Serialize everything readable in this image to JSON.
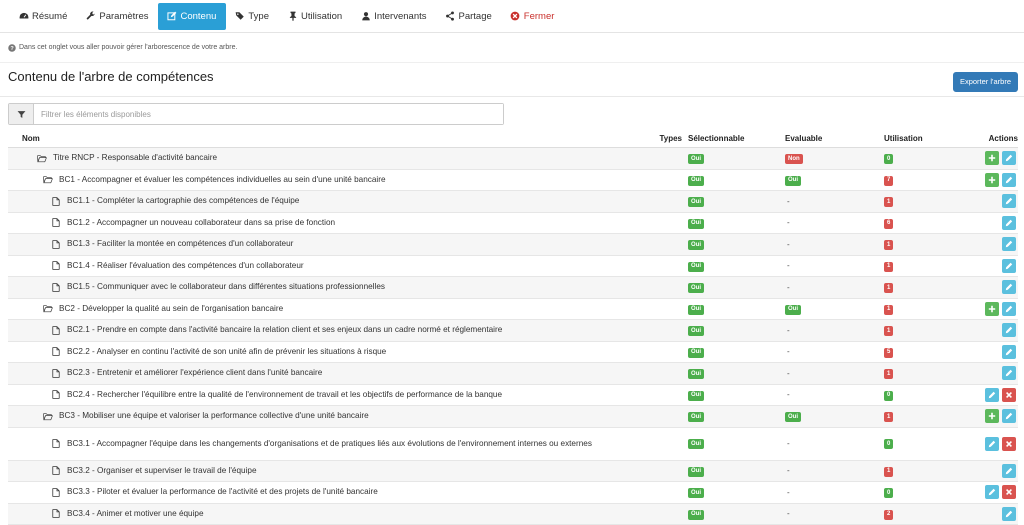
{
  "tabs": [
    {
      "id": "resume",
      "label": "Résumé",
      "icon": "dashboard-icon",
      "active": false
    },
    {
      "id": "parametres",
      "label": "Paramètres",
      "icon": "wrench-icon",
      "active": false
    },
    {
      "id": "contenu",
      "label": "Contenu",
      "icon": "edit-icon",
      "active": true
    },
    {
      "id": "type",
      "label": "Type",
      "icon": "tags-icon",
      "active": false
    },
    {
      "id": "utilisation",
      "label": "Utilisation",
      "icon": "pin-icon",
      "active": false
    },
    {
      "id": "intervenants",
      "label": "Intervenants",
      "icon": "user-icon",
      "active": false
    },
    {
      "id": "partage",
      "label": "Partage",
      "icon": "share-icon",
      "active": false
    },
    {
      "id": "fermer",
      "label": "Fermer",
      "icon": "close-circle-icon",
      "active": false
    }
  ],
  "info_text": "Dans cet onglet vous aller pouvoir gérer l'arborescence de votre arbre.",
  "page_title": "Contenu de l'arbre de compétences",
  "export_label": "Exporter l'arbre",
  "filter_placeholder": "Filtrer les éléments disponibles",
  "colors": {
    "accent": "#2a9fd6",
    "export": "#337ab7",
    "green": "#4cae4c",
    "red": "#d9534f",
    "info": "#5bc0de"
  },
  "columns": {
    "nom": "Nom",
    "types": "Types",
    "selectionnable": "Sélectionnable",
    "evaluable": "Evaluable",
    "utilisation": "Utilisation",
    "actions": "Actions"
  },
  "rows": [
    {
      "level": 0,
      "kind": "folder",
      "label": "Titre RNCP - Responsable d'activité bancaire",
      "sel": "Oui",
      "eval": "Non",
      "use": "0",
      "use_color": "green",
      "actions": [
        "add",
        "edit"
      ]
    },
    {
      "level": 1,
      "kind": "folder",
      "label": "BC1 - Accompagner et évaluer les compétences individuelles au sein d'une unité bancaire",
      "sel": "Oui",
      "eval": "Oui",
      "use": "7",
      "use_color": "red",
      "actions": [
        "add",
        "edit"
      ]
    },
    {
      "level": 2,
      "kind": "file",
      "label": "BC1.1 - Compléter la cartographie des compétences de l'équipe",
      "sel": "Oui",
      "eval": "-",
      "use": "1",
      "use_color": "red",
      "actions": [
        "edit"
      ]
    },
    {
      "level": 2,
      "kind": "file",
      "label": "BC1.2 - Accompagner un nouveau collaborateur dans sa prise de fonction",
      "sel": "Oui",
      "eval": "-",
      "use": "6",
      "use_color": "red",
      "actions": [
        "edit"
      ]
    },
    {
      "level": 2,
      "kind": "file",
      "label": "BC1.3 - Faciliter la montée en compétences d'un collaborateur",
      "sel": "Oui",
      "eval": "-",
      "use": "1",
      "use_color": "red",
      "actions": [
        "edit"
      ]
    },
    {
      "level": 2,
      "kind": "file",
      "label": "BC1.4 - Réaliser l'évaluation des compétences d'un collaborateur",
      "sel": "Oui",
      "eval": "-",
      "use": "1",
      "use_color": "red",
      "actions": [
        "edit"
      ]
    },
    {
      "level": 2,
      "kind": "file",
      "label": "BC1.5 - Communiquer avec le collaborateur dans différentes situations professionnelles",
      "sel": "Oui",
      "eval": "-",
      "use": "1",
      "use_color": "red",
      "actions": [
        "edit"
      ]
    },
    {
      "level": 1,
      "kind": "folder",
      "label": "BC2 - Développer la qualité au sein de l'organisation bancaire",
      "sel": "Oui",
      "eval": "Oui",
      "use": "1",
      "use_color": "red",
      "actions": [
        "add",
        "edit"
      ]
    },
    {
      "level": 2,
      "kind": "file",
      "label": "BC2.1 - Prendre en compte dans l'activité bancaire la relation client et ses enjeux dans un cadre normé et réglementaire",
      "sel": "Oui",
      "eval": "-",
      "use": "1",
      "use_color": "red",
      "actions": [
        "edit"
      ]
    },
    {
      "level": 2,
      "kind": "file",
      "label": "BC2.2 - Analyser en continu l'activité de son unité afin de prévenir les situations à risque",
      "sel": "Oui",
      "eval": "-",
      "use": "5",
      "use_color": "red",
      "actions": [
        "edit"
      ]
    },
    {
      "level": 2,
      "kind": "file",
      "label": "BC2.3 - Entretenir et améliorer l'expérience client dans l'unité bancaire",
      "sel": "Oui",
      "eval": "-",
      "use": "1",
      "use_color": "red",
      "actions": [
        "edit"
      ]
    },
    {
      "level": 2,
      "kind": "file",
      "label": "BC2.4 - Rechercher l'équilibre entre la qualité de l'environnement de travail et les objectifs de performance de la banque",
      "sel": "Oui",
      "eval": "-",
      "use": "0",
      "use_color": "green",
      "actions": [
        "edit",
        "delete"
      ]
    },
    {
      "level": 1,
      "kind": "folder",
      "label": "BC3 - Mobiliser une équipe et valoriser la performance collective d'une unité bancaire",
      "sel": "Oui",
      "eval": "Oui",
      "use": "1",
      "use_color": "red",
      "actions": [
        "add",
        "edit"
      ]
    },
    {
      "level": 2,
      "kind": "file",
      "label": "BC3.1 - Accompagner l'équipe dans les changements d'organisations et de pratiques liés aux évolutions de l'environnement internes ou externes",
      "sel": "Oui",
      "eval": "-",
      "use": "0",
      "use_color": "green",
      "actions": [
        "edit",
        "delete"
      ],
      "tall": true
    },
    {
      "level": 2,
      "kind": "file",
      "label": "BC3.2 - Organiser et superviser le travail de l'équipe",
      "sel": "Oui",
      "eval": "-",
      "use": "1",
      "use_color": "red",
      "actions": [
        "edit"
      ]
    },
    {
      "level": 2,
      "kind": "file",
      "label": "BC3.3 - Piloter et évaluer la performance de l'activité et des projets de l'unité bancaire",
      "sel": "Oui",
      "eval": "-",
      "use": "0",
      "use_color": "green",
      "actions": [
        "edit",
        "delete"
      ]
    },
    {
      "level": 2,
      "kind": "file",
      "label": "BC3.4 - Animer et motiver une équipe",
      "sel": "Oui",
      "eval": "-",
      "use": "2",
      "use_color": "red",
      "actions": [
        "edit"
      ]
    }
  ]
}
